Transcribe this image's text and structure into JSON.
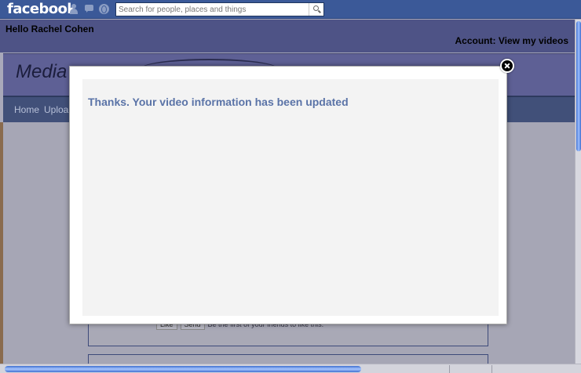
{
  "facebook_bar": {
    "logo": "facebook",
    "search_placeholder": "Search for people, places and things",
    "icons": [
      "friends-icon",
      "messages-icon",
      "notifications-globe-icon",
      "search-icon"
    ]
  },
  "app": {
    "greeting": "Hello Rachel Cohen",
    "account_link": "Account: View my videos",
    "title_partial": "Media",
    "nav": [
      "Home",
      "Uploa"
    ],
    "like_bar": {
      "like_label": "Like",
      "send_label": "Send",
      "social_text": "Be the first of your friends to like this."
    }
  },
  "modal": {
    "message": "Thanks. Your video information has been updated",
    "close_icon": "close-icon"
  },
  "colors": {
    "fb_blue": "#3b5998",
    "modal_text": "#5a73a7",
    "scroll_thumb": "#5b8ef0"
  }
}
